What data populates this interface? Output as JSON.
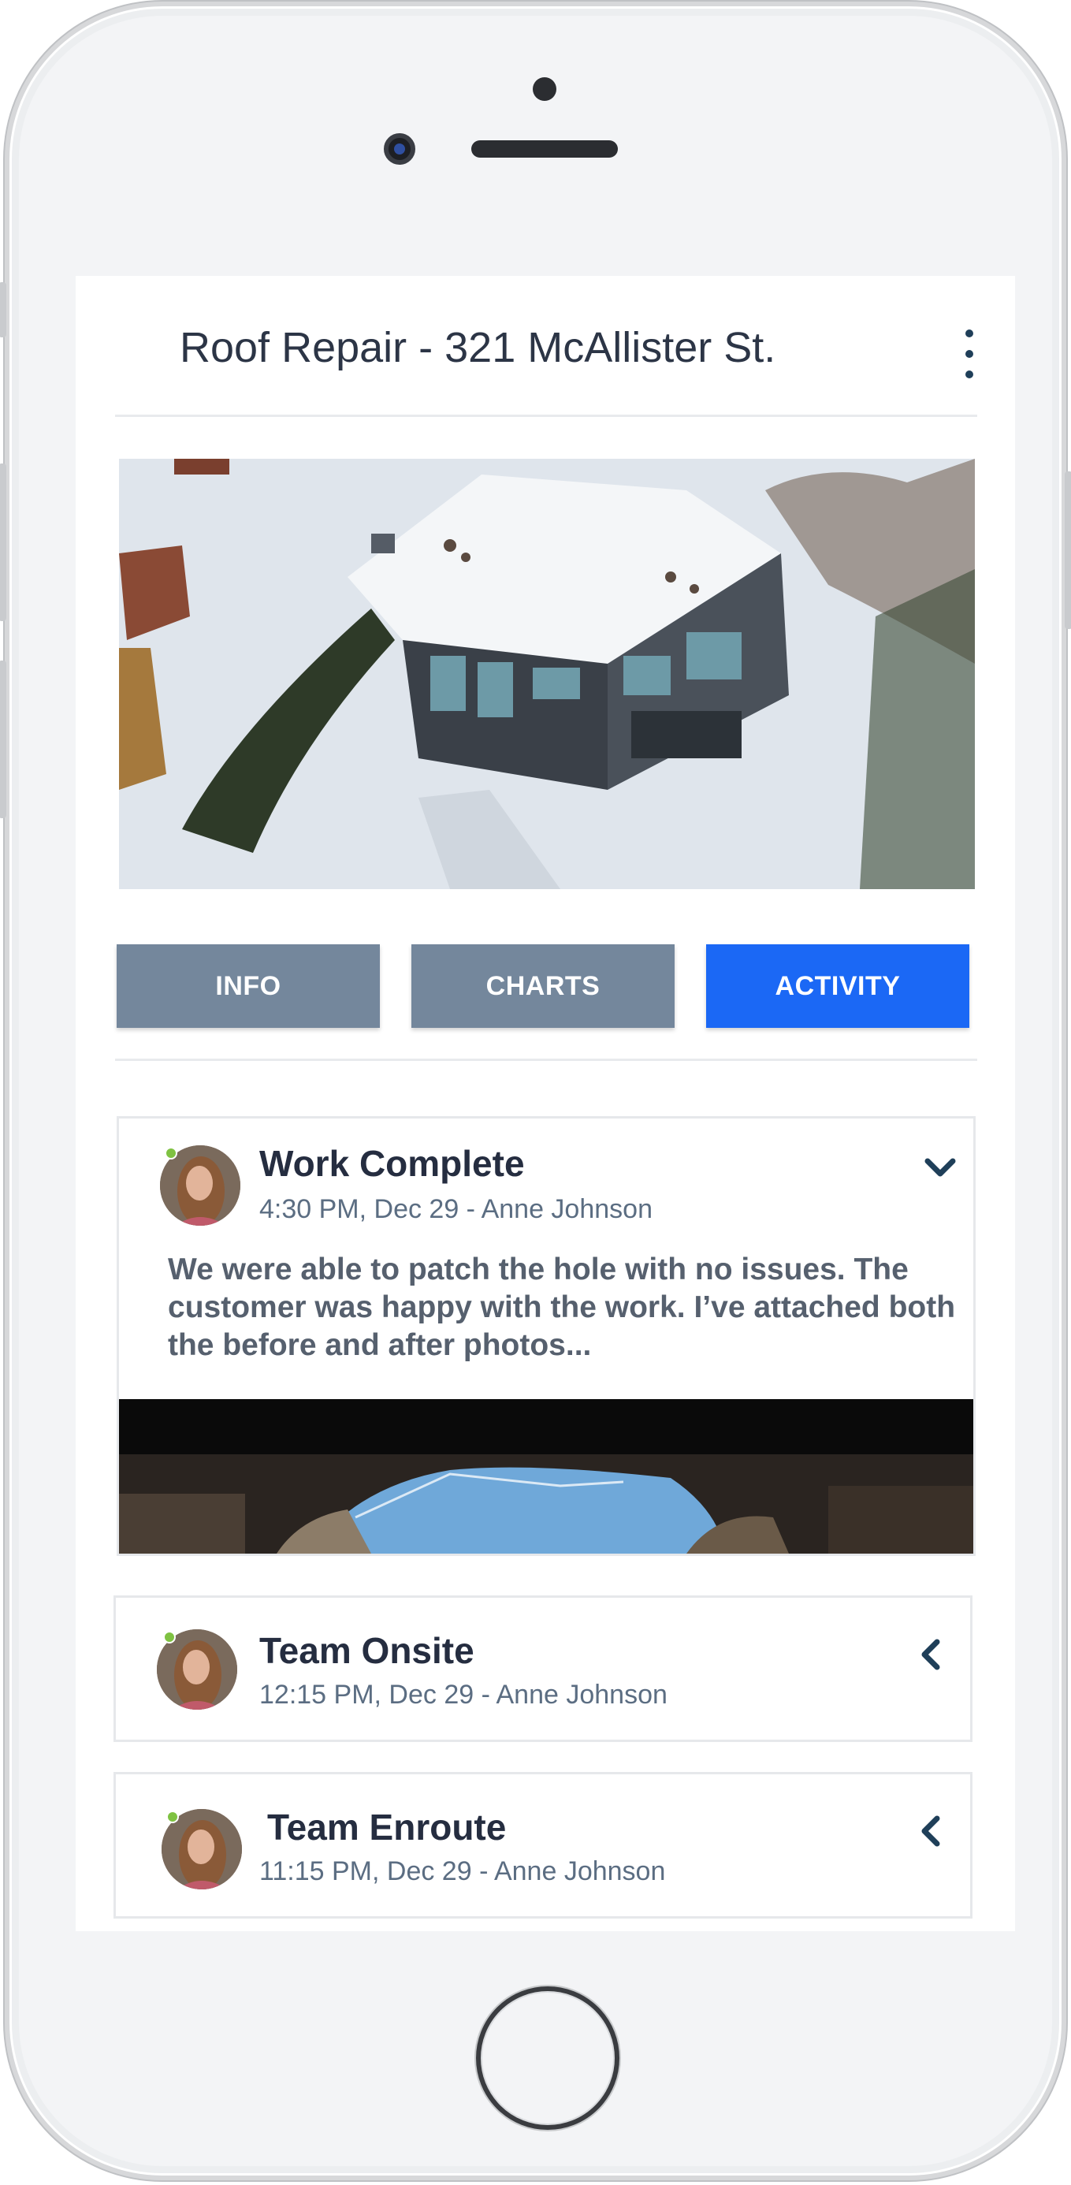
{
  "header": {
    "title": "Roof Repair - 321 McAllister St."
  },
  "tabs": [
    {
      "label": "INFO",
      "active": false
    },
    {
      "label": "CHARTS",
      "active": false
    },
    {
      "label": "ACTIVITY",
      "active": true
    }
  ],
  "activity": [
    {
      "title": "Work Complete",
      "meta": "4:30 PM, Dec 29 - Anne Johnson",
      "body": "We were able to patch the hole with no issues.  The customer was happy with the work.  I’ve attached both the before and after photos...",
      "expanded": true,
      "status": "online"
    },
    {
      "title": "Team Onsite",
      "meta": "12:15 PM, Dec 29 - Anne Johnson",
      "expanded": false,
      "status": "online"
    },
    {
      "title": "Team Enroute",
      "meta": "11:15 PM, Dec 29 - Anne Johnson",
      "expanded": false,
      "status": "online"
    }
  ],
  "icons": {
    "menu": "more-vertical-icon",
    "expanded": "chevron-down-icon",
    "collapsed": "chevron-left-icon"
  },
  "colors": {
    "accent": "#1b68f5",
    "tab_inactive": "#74879c",
    "title_text": "#2c3546",
    "meta_text": "#5b6d82",
    "status_online": "#7fc242",
    "chevron": "#1f3f59"
  }
}
